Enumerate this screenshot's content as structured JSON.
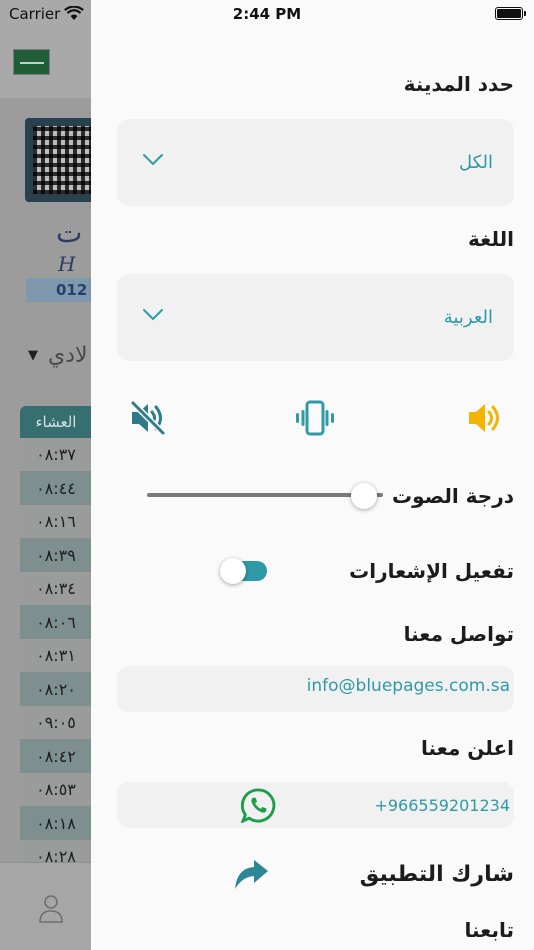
{
  "status_bar": {
    "carrier": "Carrier",
    "time": "2:44 PM"
  },
  "background": {
    "logo_line1": "ت",
    "logo_line2": "H",
    "logo_number": "012",
    "city_label": "لادي",
    "table": {
      "header": "العشاء",
      "times": [
        "٠٨:٣٧",
        "٠٨:٤٤",
        "٠٨:١٦",
        "٠٨:٣٩",
        "٠٨:٣٤",
        "٠٨:٠٦",
        "٠٨:٣١",
        "٠٨:٢٠",
        "٠٩:٠٥",
        "٠٨:٤٢",
        "٠٨:٥٣",
        "٠٨:١٨",
        "٠٨:٢٨"
      ]
    }
  },
  "drawer": {
    "city": {
      "title": "حدد المدينة",
      "value": "الكل"
    },
    "language": {
      "title": "اللغة",
      "value": "العربية"
    },
    "sound_modes": {
      "icons": [
        "speaker-on-icon",
        "vibrate-icon",
        "mute-icon"
      ],
      "colors": {
        "speaker": "#F5B400",
        "vibrate": "#2E9AA6",
        "mute": "#2E7C88"
      }
    },
    "volume": {
      "label": "درجة الصوت",
      "level": 0.92
    },
    "notifications": {
      "label": "تفعيل الإشعارات",
      "enabled": true
    },
    "contact": {
      "title": "تواصل معنا",
      "email": "info@bluepages.com.sa"
    },
    "advertise": {
      "title": "اعلن معنا",
      "phone": "+966559201234"
    },
    "share": {
      "title": "شارك التطبيق"
    },
    "follow": {
      "title": "تابعنا"
    },
    "colors": {
      "accent": "#2E9AA6",
      "whatsapp": "#1E9E4A"
    }
  }
}
